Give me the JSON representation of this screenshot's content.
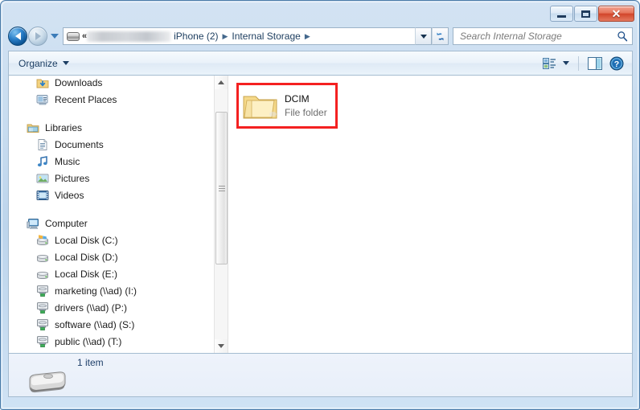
{
  "window": {
    "controls": {
      "minimize_label": "Minimize",
      "maximize_label": "Maximize",
      "close_label": "✕"
    }
  },
  "address_bar": {
    "device_icon": "portable-device-icon",
    "overflow_chevrons": "«",
    "redacted_segment": "",
    "crumbs": [
      {
        "label": "iPhone (2)",
        "separator": "▶"
      },
      {
        "label": "Internal Storage",
        "separator": "▶"
      }
    ],
    "history_dropdown_icon": "chevron-down-icon",
    "refresh_icon": "refresh-icon"
  },
  "search": {
    "placeholder": "Search Internal Storage",
    "icon": "search-icon"
  },
  "toolbar": {
    "organize_label": "Organize",
    "organize_caret": "chevron-down-icon",
    "view_icon": "view-options-icon",
    "view_caret": "chevron-down-icon",
    "preview_pane_icon": "preview-pane-icon",
    "help_icon": "help-icon"
  },
  "sidebar": {
    "items": [
      {
        "label": "Downloads",
        "icon": "downloads-folder-icon",
        "level": "child"
      },
      {
        "label": "Recent Places",
        "icon": "recent-places-icon",
        "level": "child"
      },
      {
        "label": "Libraries",
        "icon": "libraries-icon",
        "level": "root"
      },
      {
        "label": "Documents",
        "icon": "documents-icon",
        "level": "child"
      },
      {
        "label": "Music",
        "icon": "music-icon",
        "level": "child"
      },
      {
        "label": "Pictures",
        "icon": "pictures-icon",
        "level": "child"
      },
      {
        "label": "Videos",
        "icon": "videos-icon",
        "level": "child"
      },
      {
        "label": "Computer",
        "icon": "computer-icon",
        "level": "root"
      },
      {
        "label": "Local Disk (C:)",
        "icon": "system-disk-icon",
        "level": "child"
      },
      {
        "label": "Local Disk (D:)",
        "icon": "disk-icon",
        "level": "child"
      },
      {
        "label": "Local Disk (E:)",
        "icon": "disk-icon",
        "level": "child"
      },
      {
        "label": "marketing (\\\\ad) (I:)",
        "icon": "network-drive-icon",
        "level": "child"
      },
      {
        "label": "drivers (\\\\ad) (P:)",
        "icon": "network-drive-icon",
        "level": "child"
      },
      {
        "label": "software (\\\\ad) (S:)",
        "icon": "network-drive-icon",
        "level": "child"
      },
      {
        "label": "public (\\\\ad) (T:)",
        "icon": "network-drive-icon",
        "level": "child"
      }
    ],
    "scrollbar": {
      "up_arrow": "scroll-up-arrow",
      "down_arrow": "scroll-down-arrow"
    }
  },
  "content": {
    "file": {
      "name": "DCIM",
      "type": "File folder",
      "icon": "folder-icon",
      "highlight_color": "#f42121"
    }
  },
  "status_bar": {
    "item_count": "1 item",
    "device_icon": "portable-drive-icon"
  }
}
